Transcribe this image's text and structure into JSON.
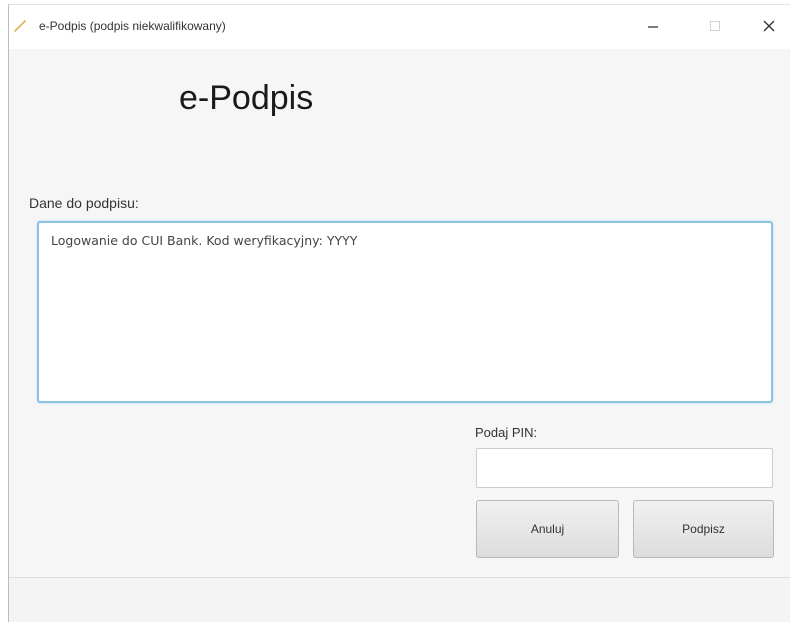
{
  "window": {
    "title": "e-Podpis (podpis niekwalifikowany)",
    "controls": {
      "minimize": "—",
      "maximize": "",
      "close": "✕"
    }
  },
  "main": {
    "heading": "e-Podpis",
    "data_label": "Dane do podpisu:",
    "data_text": "Logowanie do CUI Bank. Kod weryfikacyjny: YYYY",
    "pin_label": "Podaj PIN:",
    "pin_value": "",
    "cancel_label": "Anuluj",
    "sign_label": "Podpisz"
  },
  "icons": {
    "app": "pen-icon",
    "minimize": "minimize-icon",
    "maximize": "maximize-icon",
    "close": "close-icon"
  },
  "colors": {
    "focus_border": "#8cc3e3",
    "app_icon": "#d9b35a"
  }
}
